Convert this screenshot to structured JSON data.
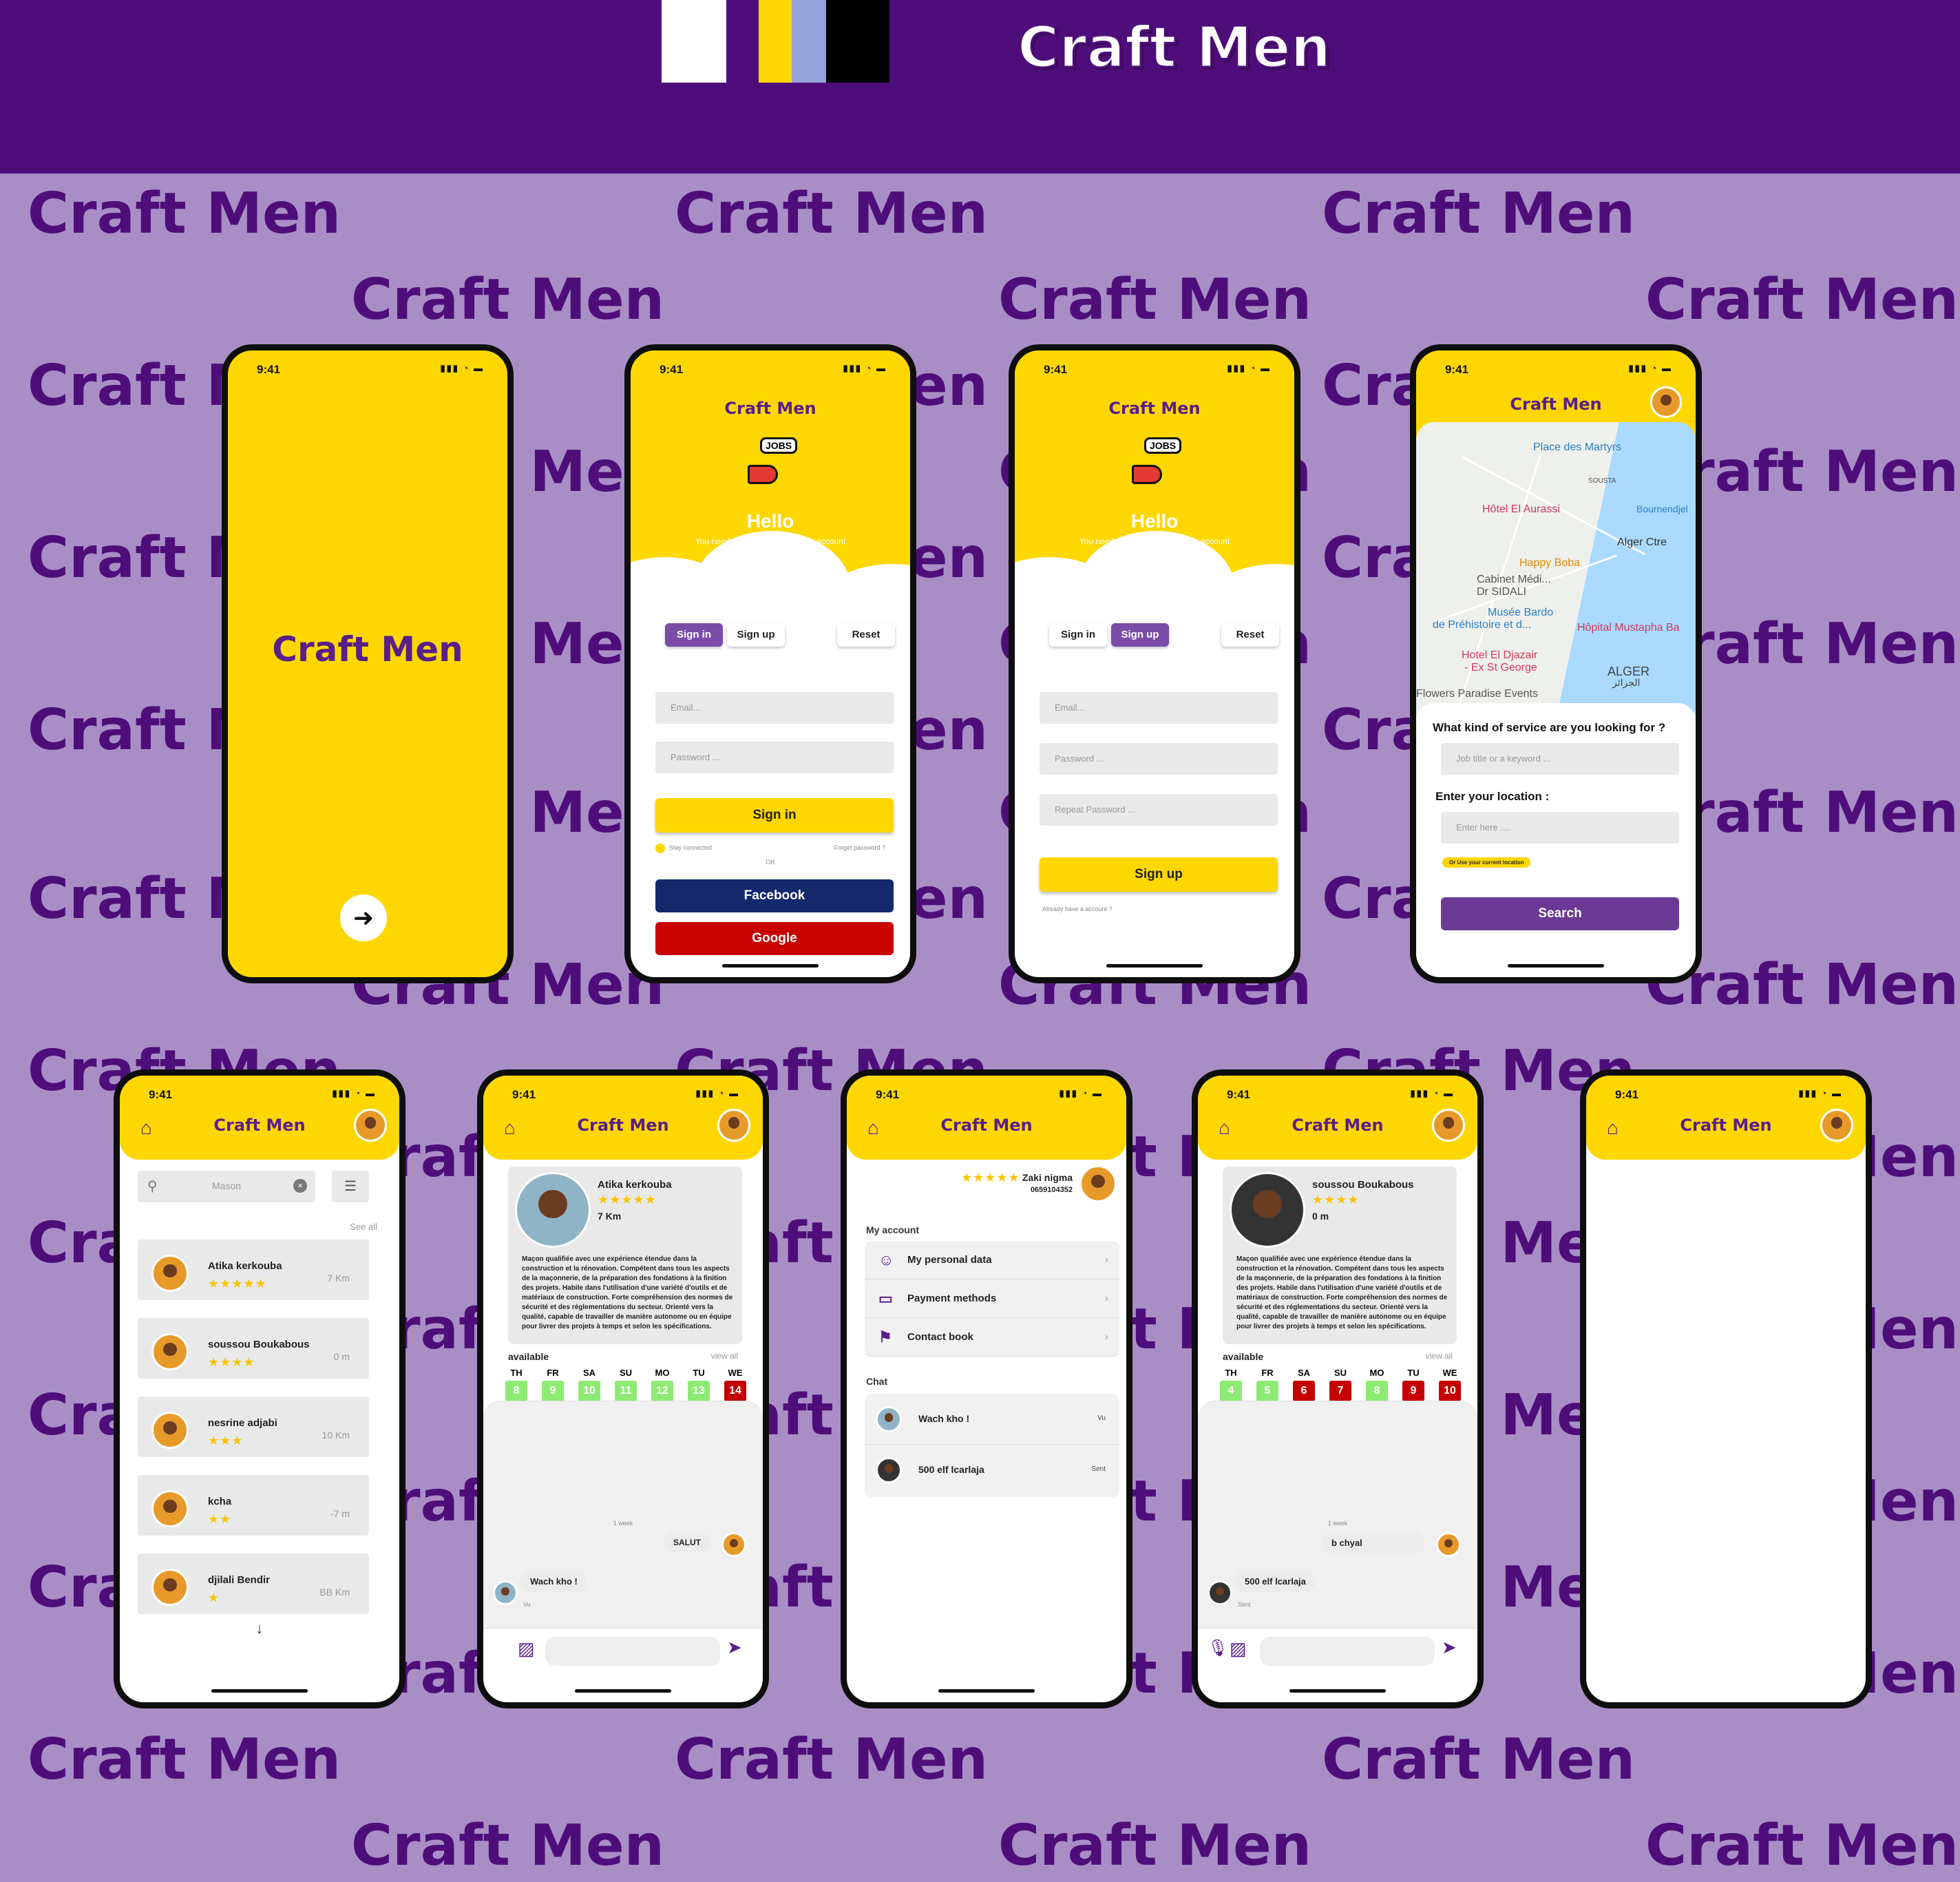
{
  "brand": {
    "title": "Craft Men",
    "palette": [
      "#FFFFFF",
      "#FED700",
      "#96A3DA",
      "#000000"
    ]
  },
  "status": {
    "time": "9:41"
  },
  "auth": {
    "hello": "Hello",
    "subtitle": "You need to sign up or create an account",
    "jobs": "JOBS",
    "tab_signin": "Sign in",
    "tab_signup": "Sign up",
    "tab_reset": "Reset",
    "email_ph": "Email...",
    "password_ph": "Password ...",
    "repeat_ph": "Repeat Password ...",
    "signin_btn": "Sign in",
    "signup_btn": "Sign up",
    "stay": "Stay connected",
    "forgot": "Forget password ?",
    "or": "OR",
    "facebook": "Facebook",
    "google": "Google",
    "already": "Already have a account ?"
  },
  "map": {
    "labels": [
      "Place des Martyrs",
      "Hôtel El Aurassi",
      "Happy Boba",
      "Cabinet Médi...",
      "Dr SIDALI",
      "Musée Bardo",
      "de Préhistoire et d...",
      "Hôpital Mustapha Ba",
      "Hotel El Djazair",
      "- Ex St George",
      "ALGER",
      "الجزائر",
      "Flowers Paradise Events",
      "Bournendjel",
      "Alger Ctre",
      "SOUSTA"
    ],
    "question": "What kind of service are you looking for ?",
    "job_ph": "Job title or a keyword ...",
    "location_label": "Enter your location :",
    "location_ph": "Enter here ....",
    "current_location": "Or Use your current location",
    "search_btn": "Search"
  },
  "search": {
    "query": "Mason",
    "see_all": "See all",
    "results": [
      {
        "name": "Atika kerkouba",
        "stars": "★★★★★",
        "dist": "7 Km"
      },
      {
        "name": "soussou Boukabous",
        "stars": "★★★★",
        "dist": "0 m"
      },
      {
        "name": "nesrine adjabi",
        "stars": "★★★",
        "dist": "10 Km"
      },
      {
        "name": "kcha",
        "stars": "★★",
        "dist": "-7 m"
      },
      {
        "name": "djilali Bendir",
        "stars": "★",
        "dist": "BB Km"
      }
    ],
    "more": "↓"
  },
  "profile1": {
    "name": "Atika kerkouba",
    "stars": "★★★★★",
    "dist": "7 Km",
    "bio": "Maçon qualifiée avec une expérience étendue dans la construction et la rénovation. Compétent dans tous les aspects de la maçonnerie, de la préparation des fondations à la finition des projets. Habile dans l'utilisation d'une variété d'outils et de matériaux de construction. Forte compréhension des normes de sécurité et des réglementations du secteur. Orienté vers la qualité, capable de travailler de manière autonome ou en équipe pour livrer des projets à temps et selon les spécifications.",
    "available": "available",
    "view_all": "view all",
    "days": [
      {
        "d": "TH",
        "n": "8",
        "s": "g"
      },
      {
        "d": "FR",
        "n": "9",
        "s": "g"
      },
      {
        "d": "SA",
        "n": "10",
        "s": "g"
      },
      {
        "d": "SU",
        "n": "11",
        "s": "g"
      },
      {
        "d": "MO",
        "n": "12",
        "s": "g"
      },
      {
        "d": "TU",
        "n": "13",
        "s": "g"
      },
      {
        "d": "WE",
        "n": "14",
        "s": "r"
      }
    ],
    "week": "1 week",
    "msg_out": "SALUT",
    "msg_in": "Wach kho !",
    "msg_in_status": "Vu"
  },
  "account": {
    "name": "Zaki nigma",
    "stars": "★★★★★",
    "phone": "0659104352",
    "my_account": "My account",
    "items": [
      "My personal data",
      "Payment methods",
      "Contact book"
    ],
    "chat": "Chat",
    "chats": [
      {
        "text": "Wach kho !",
        "tag": "Vu"
      },
      {
        "text": "500 elf lcarlaja",
        "tag": "Sent"
      }
    ]
  },
  "profile2": {
    "name": "soussou Boukabous",
    "stars": "★★★★",
    "dist": "0 m",
    "available": "available",
    "view_all": "view all",
    "days": [
      {
        "d": "TH",
        "n": "4",
        "s": "g"
      },
      {
        "d": "FR",
        "n": "5",
        "s": "g"
      },
      {
        "d": "SA",
        "n": "6",
        "s": "r"
      },
      {
        "d": "SU",
        "n": "7",
        "s": "r"
      },
      {
        "d": "MO",
        "n": "8",
        "s": "g"
      },
      {
        "d": "TU",
        "n": "9",
        "s": "r"
      },
      {
        "d": "WE",
        "n": "10",
        "s": "r"
      }
    ],
    "week": "1 week",
    "msg_out": "b chyal",
    "msg_in": "500 elf lcarlaja",
    "msg_in_status": "Sent"
  }
}
